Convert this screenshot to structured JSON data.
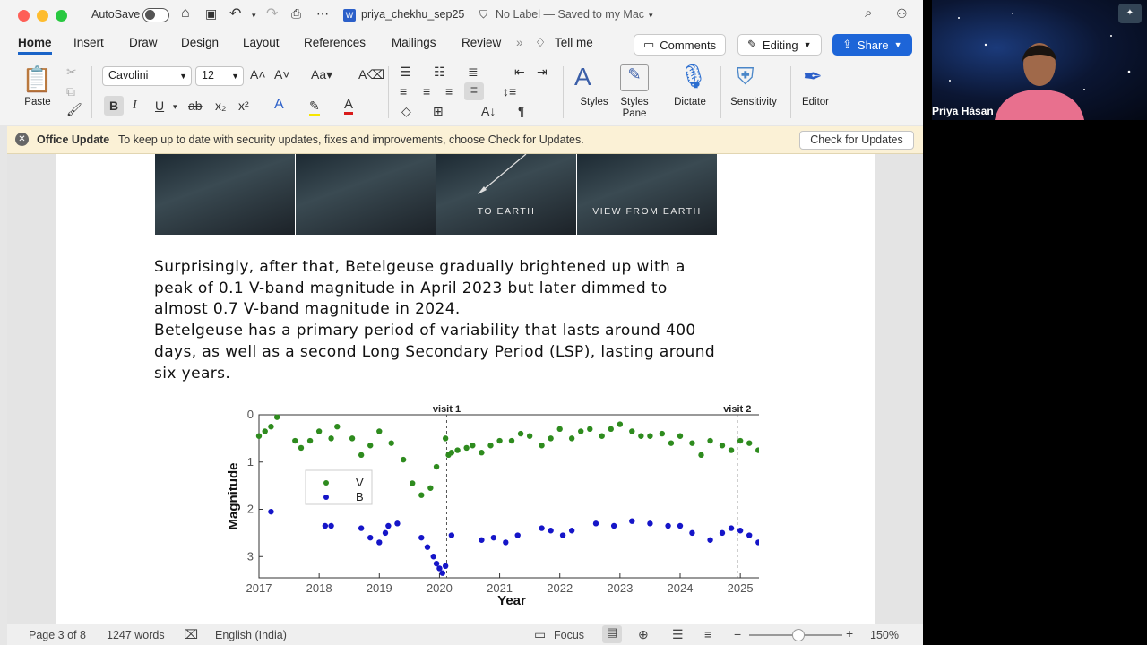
{
  "titlebar": {
    "autosave_label": "AutoSave",
    "doc_name": "priya_chekhu_sep25",
    "label_status": "No Label — Saved to my Mac"
  },
  "tabs": [
    "Home",
    "Insert",
    "Draw",
    "Design",
    "Layout",
    "References",
    "Mailings",
    "Review"
  ],
  "tell_me": "Tell me",
  "buttons": {
    "comments": "Comments",
    "editing": "Editing",
    "share": "Share"
  },
  "ribbon": {
    "paste": "Paste",
    "font_name": "Cavolini",
    "font_size": "12",
    "styles": "Styles",
    "styles_pane": [
      "Styles",
      "Pane"
    ],
    "dictate": "Dictate",
    "sensitivity": "Sensitivity",
    "editor": "Editor"
  },
  "update_bar": {
    "title": "Office Update",
    "message": "To keep up to date with security updates, fixes and improvements, choose Check for Updates.",
    "button": "Check for Updates"
  },
  "document": {
    "strip_captions": [
      "",
      "",
      "TO EARTH",
      "VIEW FROM EARTH"
    ],
    "lines": [
      "Surprisingly, after that, Betelgeuse gradually brightened up with a",
      "peak of  0.1 V-band magnitude in April 2023 but later dimmed to",
      "almost 0.7 V-band magnitude in 2024.",
      "Betelgeuse has a primary period of variability that lasts around 400",
      "days, as well as a second Long Secondary Period (LSP), lasting around",
      "six years."
    ]
  },
  "chart_data": {
    "type": "scatter",
    "xlabel": "Year",
    "ylabel": "Magnitude",
    "xlim": [
      2017,
      2025.4
    ],
    "ylim": [
      3.45,
      0
    ],
    "x_ticks": [
      "2017",
      "2018",
      "2019",
      "2020",
      "2021",
      "2022",
      "2023",
      "2024",
      "2025"
    ],
    "y_ticks": [
      "0",
      "1",
      "2",
      "3"
    ],
    "annotations": [
      {
        "text": "visit 1",
        "x": 2020.12
      },
      {
        "text": "visit 2",
        "x": 2024.95
      }
    ],
    "legend": [
      "V",
      "B"
    ],
    "legend_position": "left",
    "colors": {
      "V": "#2e8b1e",
      "B": "#1515c8"
    },
    "series": [
      {
        "name": "V",
        "x": [
          2017.0,
          2017.1,
          2017.2,
          2017.3,
          2017.6,
          2017.7,
          2017.85,
          2018.0,
          2018.2,
          2018.3,
          2018.55,
          2018.7,
          2018.85,
          2019.0,
          2019.2,
          2019.4,
          2019.55,
          2019.7,
          2019.85,
          2019.95,
          2020.1,
          2020.15,
          2020.2,
          2020.3,
          2020.45,
          2020.55,
          2020.7,
          2020.85,
          2021.0,
          2021.2,
          2021.35,
          2021.5,
          2021.7,
          2021.85,
          2022.0,
          2022.2,
          2022.35,
          2022.5,
          2022.7,
          2022.85,
          2023.0,
          2023.2,
          2023.35,
          2023.5,
          2023.7,
          2023.85,
          2024.0,
          2024.2,
          2024.35,
          2024.5,
          2024.7,
          2024.85,
          2025.0,
          2025.15,
          2025.3,
          2025.4
        ],
        "y": [
          0.45,
          0.35,
          0.25,
          0.05,
          0.55,
          0.7,
          0.55,
          0.35,
          0.5,
          0.25,
          0.5,
          0.85,
          0.65,
          0.35,
          0.6,
          0.95,
          1.45,
          1.7,
          1.55,
          1.1,
          0.5,
          0.85,
          0.8,
          0.75,
          0.7,
          0.65,
          0.8,
          0.65,
          0.55,
          0.55,
          0.4,
          0.45,
          0.65,
          0.5,
          0.3,
          0.5,
          0.35,
          0.3,
          0.45,
          0.3,
          0.2,
          0.35,
          0.45,
          0.45,
          0.4,
          0.6,
          0.45,
          0.6,
          0.85,
          0.55,
          0.65,
          0.75,
          0.55,
          0.6,
          0.75,
          0.6
        ]
      },
      {
        "name": "B",
        "x": [
          2017.2,
          2018.1,
          2018.2,
          2018.7,
          2018.85,
          2019.0,
          2019.1,
          2019.15,
          2019.3,
          2019.7,
          2019.8,
          2019.9,
          2019.95,
          2020.0,
          2020.05,
          2020.1,
          2020.2,
          2020.7,
          2020.9,
          2021.1,
          2021.3,
          2021.7,
          2021.85,
          2022.05,
          2022.2,
          2022.6,
          2022.9,
          2023.2,
          2023.5,
          2023.8,
          2024.0,
          2024.2,
          2024.5,
          2024.7,
          2024.85,
          2025.0,
          2025.15,
          2025.3
        ],
        "y": [
          2.05,
          2.35,
          2.35,
          2.4,
          2.6,
          2.7,
          2.5,
          2.35,
          2.3,
          2.6,
          2.8,
          3.0,
          3.15,
          3.25,
          3.35,
          3.2,
          2.55,
          2.65,
          2.6,
          2.7,
          2.55,
          2.4,
          2.45,
          2.55,
          2.45,
          2.3,
          2.35,
          2.25,
          2.3,
          2.35,
          2.35,
          2.5,
          2.65,
          2.5,
          2.4,
          2.45,
          2.55,
          2.7
        ]
      }
    ]
  },
  "status": {
    "page": "Page 3 of 8",
    "words": "1247 words",
    "language": "English (India)",
    "focus": "Focus",
    "zoom": "150%"
  },
  "video": {
    "participant": "Priya Hasan"
  }
}
